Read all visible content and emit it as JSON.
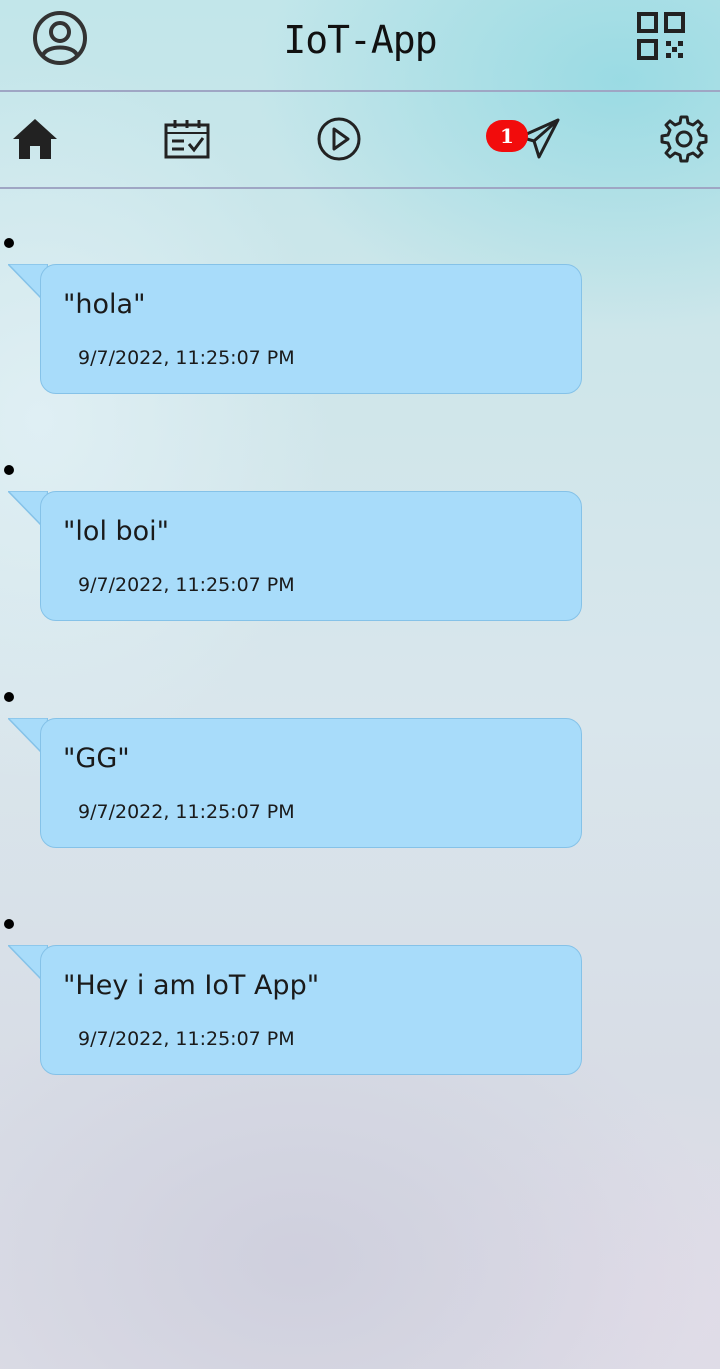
{
  "header": {
    "title": "IoT-App",
    "profile_icon": "user-circle-icon",
    "qr_icon": "qr-code-icon"
  },
  "nav": {
    "items": [
      {
        "name": "home",
        "icon": "home-icon"
      },
      {
        "name": "calendar",
        "icon": "calendar-check-icon"
      },
      {
        "name": "play",
        "icon": "play-circle-icon"
      },
      {
        "name": "messages",
        "icon": "paper-plane-icon",
        "badge": "1"
      },
      {
        "name": "settings",
        "icon": "gear-icon"
      }
    ]
  },
  "messages": [
    {
      "text": "\"hola\"",
      "time": "9/7/2022, 11:25:07 PM"
    },
    {
      "text": "\"lol boi\"",
      "time": "9/7/2022, 11:25:07 PM"
    },
    {
      "text": "\"GG\"",
      "time": "9/7/2022, 11:25:07 PM"
    },
    {
      "text": "\"Hey i am IoT App\"",
      "time": "9/7/2022, 11:25:07 PM"
    }
  ],
  "colors": {
    "bubble": "#a8dcfa",
    "bubble_border": "#85c2e8",
    "badge": "#f20c0c",
    "divider": "#9fa6c4"
  }
}
